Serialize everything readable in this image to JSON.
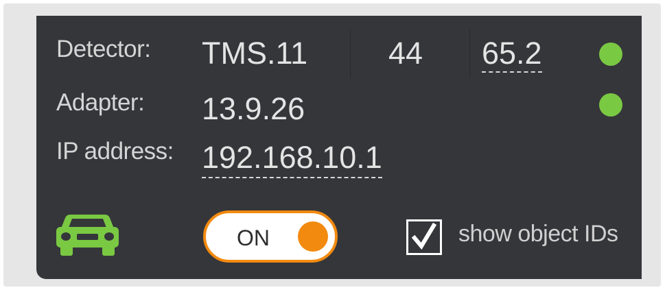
{
  "detector": {
    "label": "Detector:",
    "name": "TMS.11",
    "number": "44",
    "reading": "65.2",
    "status_color": "#7ac943"
  },
  "adapter": {
    "label": "Adapter:",
    "version": "13.9.26",
    "status_color": "#7ac943"
  },
  "ip": {
    "label": "IP address:",
    "value": "192.168.10.1"
  },
  "footer": {
    "vehicle_icon": "car-icon",
    "vehicle_color": "#7ac943",
    "toggle": {
      "label": "ON",
      "state": "on",
      "accent": "#f28a0f"
    },
    "show_ids": {
      "label": "show object IDs",
      "checked": true
    }
  }
}
